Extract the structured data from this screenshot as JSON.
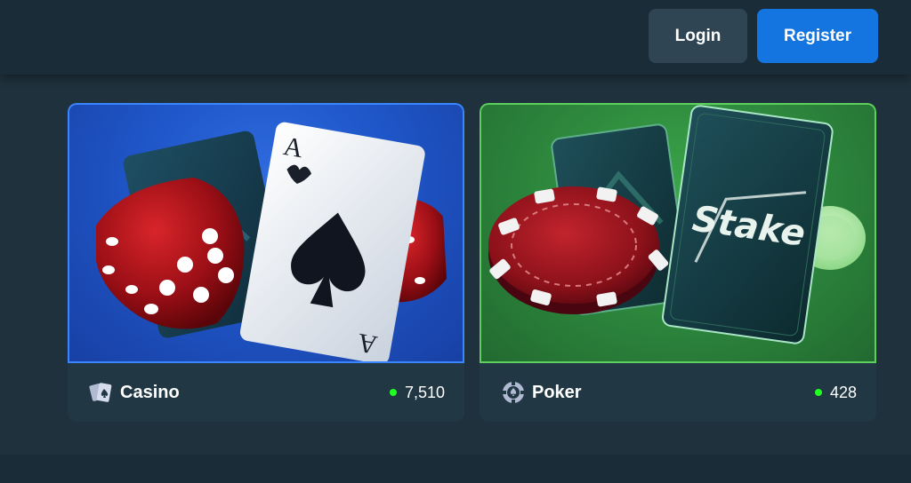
{
  "header": {
    "login_label": "Login",
    "register_label": "Register"
  },
  "cards": [
    {
      "name": "Casino",
      "icon": "cards-icon",
      "online_count": "7,510"
    },
    {
      "name": "Poker",
      "icon": "poker-chip-icon",
      "online_count": "428",
      "art_brand_text": "Stake"
    }
  ],
  "colors": {
    "background": "#1a2c38",
    "login_button": "#2f4553",
    "register_button": "#1475e1",
    "casino_border": "#3a86ff",
    "poker_border": "#5ccf5c",
    "online_dot": "#1fff20"
  }
}
